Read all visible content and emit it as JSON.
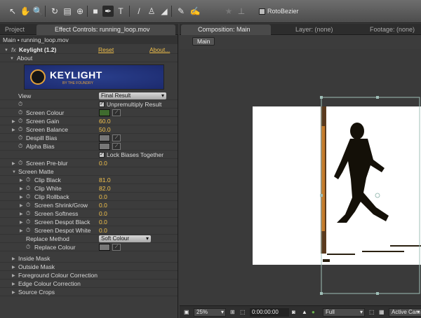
{
  "toolbar": {
    "tools": [
      "selection-tool",
      "hand-tool",
      "zoom-tool",
      "rotation-tool",
      "camera-tool",
      "pan-behind-tool",
      "rectangle-tool",
      "pen-tool",
      "type-tool",
      "brush-tool",
      "clone-stamp-tool",
      "eraser-tool",
      "roto-brush-tool",
      "puppet-tool",
      "star-icon"
    ],
    "rotobezier_label": "RotoBezier"
  },
  "left_panel": {
    "tabs": [
      "Project",
      "Effect Controls: running_loop.mov"
    ],
    "breadcrumb": "Main • running_loop.mov",
    "effect": {
      "name": "Keylight (1.2)",
      "reset": "Reset",
      "about": "About...",
      "about_group": "About",
      "logo_text": "KEYLIGHT",
      "logo_sub": "BY THE FOUNDRY"
    },
    "view": {
      "label": "View",
      "value": "Final Result"
    },
    "unpremultiply": {
      "label": "Unpremultiply Result",
      "checked": true
    },
    "params": [
      {
        "label": "Screen Colour",
        "type": "color",
        "color": "#3f6b2e"
      },
      {
        "label": "Screen Gain",
        "value": "60.0"
      },
      {
        "label": "Screen Balance",
        "value": "50.0"
      },
      {
        "label": "Despill Bias",
        "type": "color",
        "color": "#777777"
      },
      {
        "label": "Alpha Bias",
        "type": "color",
        "color": "#777777"
      }
    ],
    "lock_biases": {
      "label": "Lock Biases Together",
      "checked": true
    },
    "screen_preblur": {
      "label": "Screen Pre-blur",
      "value": "0.0"
    },
    "screen_matte": {
      "label": "Screen Matte",
      "items": [
        {
          "label": "Clip Black",
          "value": "81.0"
        },
        {
          "label": "Clip White",
          "value": "82.0"
        },
        {
          "label": "Clip Rollback",
          "value": "0.0"
        },
        {
          "label": "Screen Shrink/Grow",
          "value": "0.0"
        },
        {
          "label": "Screen Softness",
          "value": "0.0"
        },
        {
          "label": "Screen Despot Black",
          "value": "0.0"
        },
        {
          "label": "Screen Despot White",
          "value": "0.0"
        }
      ],
      "replace_method": {
        "label": "Replace Method",
        "value": "Soft Colour"
      },
      "replace_colour": {
        "label": "Replace Colour",
        "color": "#777777"
      }
    },
    "groups": [
      "Inside Mask",
      "Outside Mask",
      "Foreground Colour Correction",
      "Edge Colour Correction",
      "Source Crops"
    ]
  },
  "right_panel": {
    "tabs": [
      "Composition: Main",
      "Layer: (none)",
      "Footage: (none)"
    ],
    "comp_button": "Main",
    "bottombar": {
      "zoom": "25%",
      "timecode": "0:00:00:00",
      "resolution": "Full",
      "camera": "Active Cam"
    }
  }
}
